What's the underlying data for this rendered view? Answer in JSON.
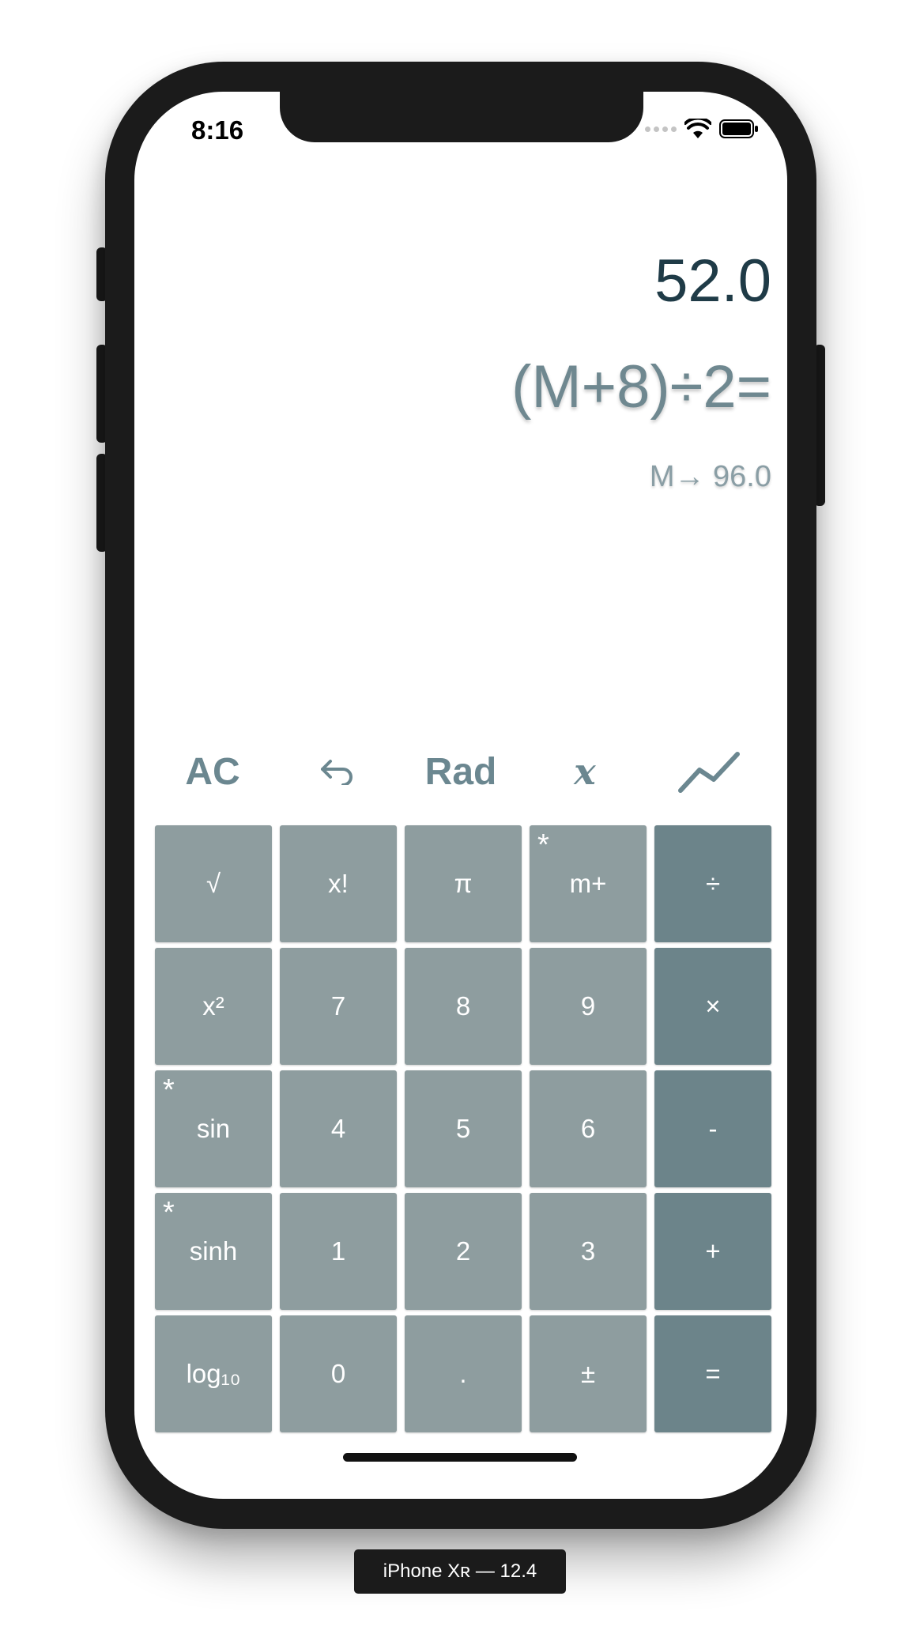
{
  "status_bar": {
    "time": "8:16"
  },
  "display": {
    "result": "52.0",
    "expression": "(M+8)÷2=",
    "memory": "M→ 96.0"
  },
  "controls": {
    "clear_label": "AC",
    "undo_icon": "undo-arrow-icon",
    "angle_mode_label": "Rad",
    "variable_label": "x",
    "graph_icon": "line-graph-icon"
  },
  "keypad": {
    "keys": [
      {
        "label": "√",
        "type": "function",
        "star": false
      },
      {
        "label": "x!",
        "type": "function",
        "star": false
      },
      {
        "label": "π",
        "type": "function",
        "star": false
      },
      {
        "label": "m+",
        "type": "function",
        "star": true
      },
      {
        "label": "÷",
        "type": "operator",
        "star": false
      },
      {
        "label": "x²",
        "type": "function",
        "star": false
      },
      {
        "label": "7",
        "type": "digit",
        "star": false
      },
      {
        "label": "8",
        "type": "digit",
        "star": false
      },
      {
        "label": "9",
        "type": "digit",
        "star": false
      },
      {
        "label": "×",
        "type": "operator",
        "star": false
      },
      {
        "label": "sin",
        "type": "function",
        "star": true
      },
      {
        "label": "4",
        "type": "digit",
        "star": false
      },
      {
        "label": "5",
        "type": "digit",
        "star": false
      },
      {
        "label": "6",
        "type": "digit",
        "star": false
      },
      {
        "label": "-",
        "type": "operator",
        "star": false
      },
      {
        "label": "sinh",
        "type": "function",
        "star": true
      },
      {
        "label": "1",
        "type": "digit",
        "star": false
      },
      {
        "label": "2",
        "type": "digit",
        "star": false
      },
      {
        "label": "3",
        "type": "digit",
        "star": false
      },
      {
        "label": "+",
        "type": "operator",
        "star": false
      },
      {
        "label": "log₁₀",
        "type": "function",
        "star": false
      },
      {
        "label": "0",
        "type": "digit",
        "star": false
      },
      {
        "label": ".",
        "type": "digit",
        "star": false
      },
      {
        "label": "±",
        "type": "function",
        "star": false
      },
      {
        "label": "=",
        "type": "operator",
        "star": false
      }
    ],
    "star_symbol": "*"
  },
  "device_label": "iPhone Xʀ — 12.4",
  "colors": {
    "key_bg": "#8e9d9f",
    "operator_bg": "#6c848a",
    "result_text": "#1f3b47",
    "control_text": "#6b8790"
  }
}
